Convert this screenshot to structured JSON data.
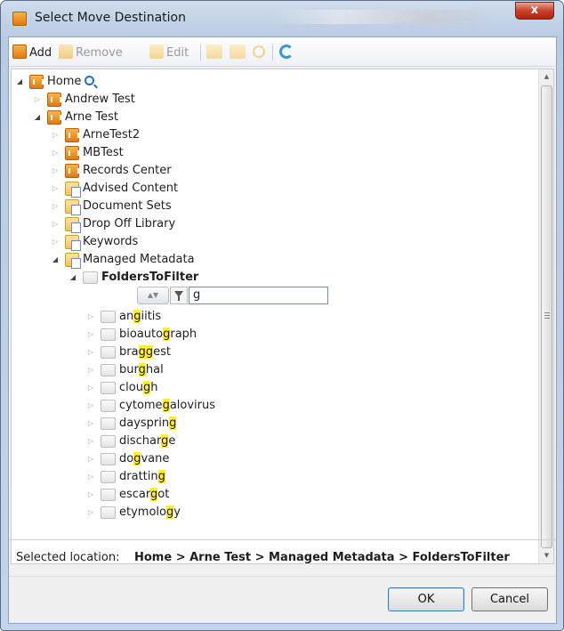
{
  "window": {
    "title": "Select Move Destination",
    "close_glyph": "x"
  },
  "toolbar": {
    "add_label": "Add",
    "remove_label": "Remove",
    "edit_label": "Edit"
  },
  "tree": {
    "home": {
      "label": "Home"
    },
    "sites": [
      {
        "label": "Andrew Test"
      },
      {
        "label": "Arne Test"
      }
    ],
    "arne_children": [
      {
        "label": "ArneTest2",
        "type": "site"
      },
      {
        "label": "MBTest",
        "type": "site"
      },
      {
        "label": "Records Center",
        "type": "site"
      },
      {
        "label": "Advised Content",
        "type": "lib"
      },
      {
        "label": "Document Sets",
        "type": "lib"
      },
      {
        "label": "Drop Off Library",
        "type": "lib"
      },
      {
        "label": "Keywords",
        "type": "lib"
      },
      {
        "label": "Managed Metadata",
        "type": "lib"
      }
    ],
    "selected_folder": {
      "label": "FoldersToFilter"
    },
    "filter": {
      "value": "g"
    },
    "folders": [
      {
        "pre": "an",
        "hl": "g",
        "post": "iitis"
      },
      {
        "pre": "bioauto",
        "hl": "g",
        "post": "raph"
      },
      {
        "pre": "bra",
        "hl": "gg",
        "post": "est"
      },
      {
        "pre": "bur",
        "hl": "g",
        "post": "hal"
      },
      {
        "pre": "clou",
        "hl": "g",
        "post": "h"
      },
      {
        "pre": "cytome",
        "hl": "g",
        "post": "alovirus"
      },
      {
        "pre": "daysprin",
        "hl": "g",
        "post": ""
      },
      {
        "pre": "dischar",
        "hl": "g",
        "post": "e"
      },
      {
        "pre": "do",
        "hl": "g",
        "post": "vane"
      },
      {
        "pre": "drattin",
        "hl": "g",
        "post": ""
      },
      {
        "pre": "escar",
        "hl": "g",
        "post": "ot"
      },
      {
        "pre": "etymolo",
        "hl": "g",
        "post": "y"
      }
    ]
  },
  "status": {
    "label": "Selected location:",
    "path": "Home > Arne Test > Managed Metadata > FoldersToFilter"
  },
  "buttons": {
    "ok": "OK",
    "cancel": "Cancel"
  },
  "colors": {
    "highlight": "#ffee33",
    "site_icon": "#e27a12",
    "accent_blue": "#1f6fd1"
  }
}
